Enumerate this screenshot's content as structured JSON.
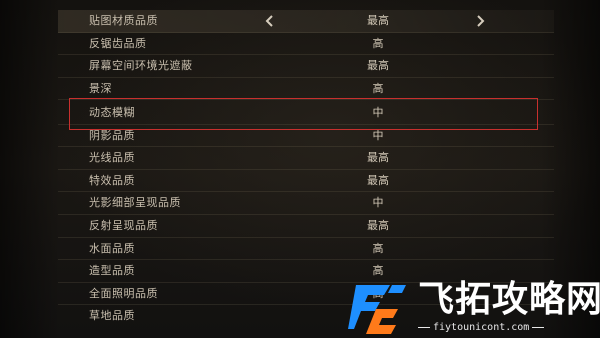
{
  "settings": {
    "rows": [
      {
        "label": "贴图材质品质",
        "value": "最高",
        "has_arrows": true
      },
      {
        "label": "反锯齿品质",
        "value": "高"
      },
      {
        "label": "屏幕空间环境光遮蔽",
        "value": "最高"
      },
      {
        "label": "景深",
        "value": "高"
      },
      {
        "label": "动态模糊",
        "value": "中"
      },
      {
        "label": "阴影品质",
        "value": "中"
      },
      {
        "label": "光线品质",
        "value": "最高"
      },
      {
        "label": "特效品质",
        "value": "最高"
      },
      {
        "label": "光影细部呈现品质",
        "value": "中"
      },
      {
        "label": "反射呈现品质",
        "value": "最高"
      },
      {
        "label": "水面品质",
        "value": "高"
      },
      {
        "label": "造型品质",
        "value": "高"
      },
      {
        "label": "全面照明品质",
        "value": "高"
      },
      {
        "label": "草地品质",
        "value": ""
      }
    ]
  },
  "highlighted_row": "动态模糊",
  "icons": {
    "left_arrow": "chevron-left-icon",
    "right_arrow": "chevron-right-icon"
  },
  "colors": {
    "highlight_border": "#c8302e",
    "text": "#c9bfae",
    "logo_blue": "#1e8fff",
    "logo_orange": "#ff7a1a"
  },
  "watermark": {
    "title": "飞拓攻略网",
    "url": "fiytounicont.com"
  }
}
